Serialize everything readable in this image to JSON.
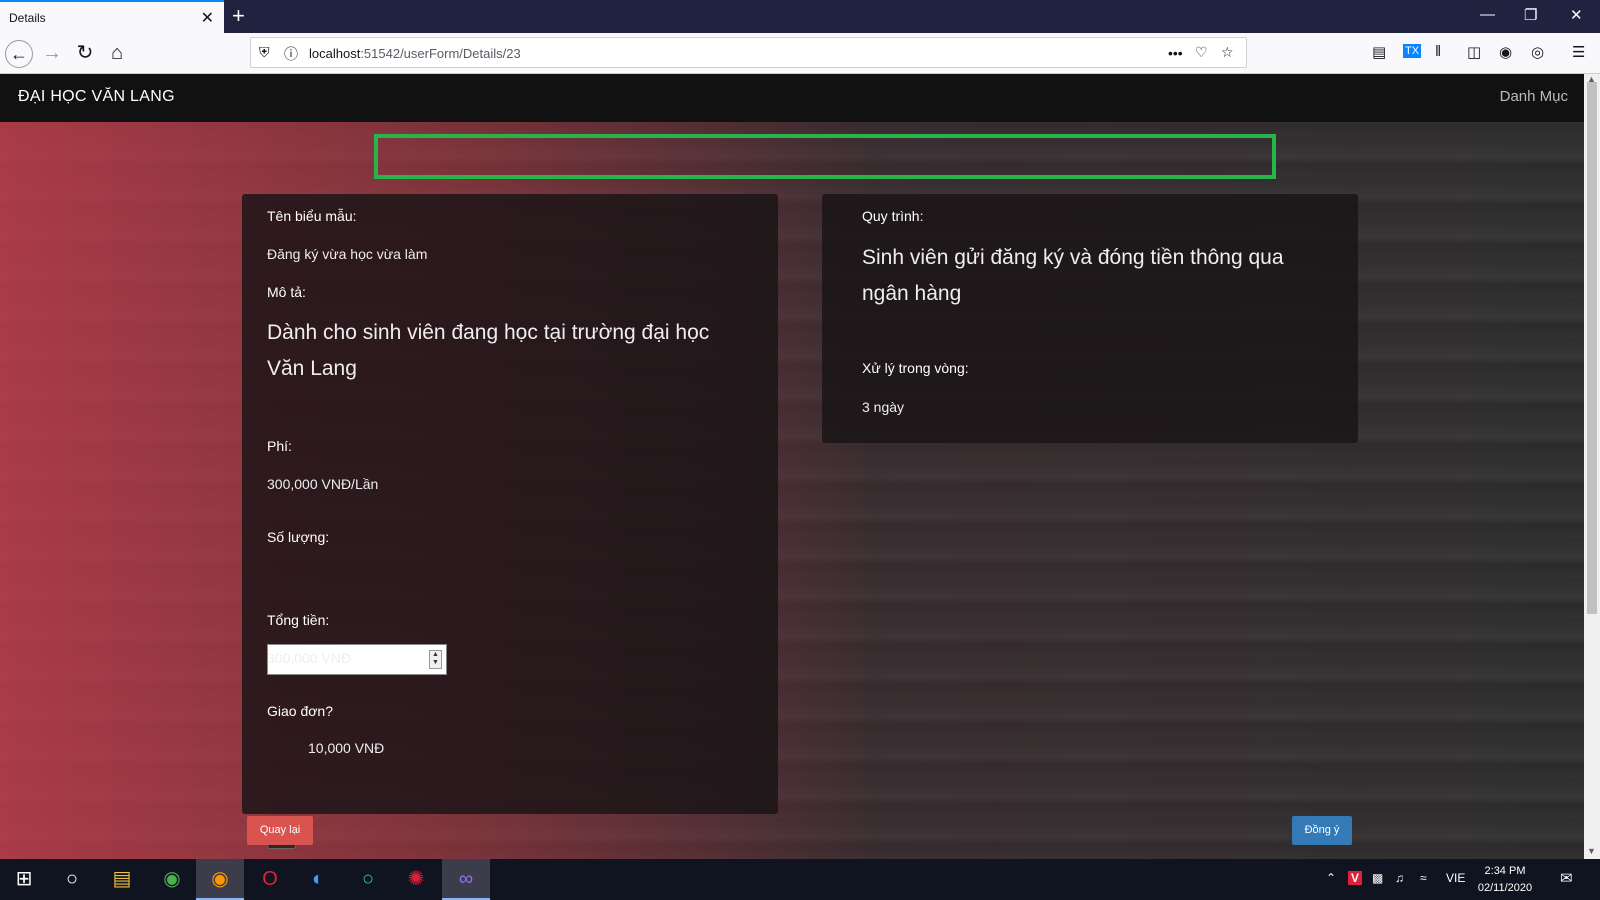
{
  "browser": {
    "tab_title": "Details",
    "tab_close": "✕",
    "new_tab": "+",
    "url_host": "localhost",
    "url_rest": ":51542/userForm/Details/23",
    "url_more": "•••"
  },
  "site": {
    "brand": "ĐẠI HỌC VĂN LANG",
    "menu": "Danh Mục"
  },
  "form": {
    "name_label": "Tên biểu mẫu:",
    "name_value": "Đăng ký vừa học vừa làm",
    "desc_label": "Mô tả:",
    "desc_value": "Dành cho sinh viên đang học tại trường đại học Văn Lang",
    "fee_label": "Phí:",
    "fee_value": "300,000 VNĐ/Lần",
    "qty_label": "Số lượng:",
    "qty_value": "",
    "total_label": "Tổng tiền:",
    "total_value": "300,000 VNĐ",
    "delivery_label": "Giao đơn?",
    "delivery_fee": "10,000 VNĐ",
    "process_label": "Quy trình:",
    "process_value": "Sinh viên gửi đăng ký và đóng tiền thông qua ngân hàng",
    "time_label": "Xử lý trong vòng:",
    "time_value": "3 ngày"
  },
  "buttons": {
    "back": "Quay lại",
    "confirm": "Đồng ý"
  },
  "taskbar": {
    "time": "2:34 PM",
    "date": "02/11/2020",
    "lang": "VIE"
  },
  "colors": {
    "highlight": "#28b44a",
    "back_button": "#d9534f",
    "confirm_button": "#337ab7"
  }
}
